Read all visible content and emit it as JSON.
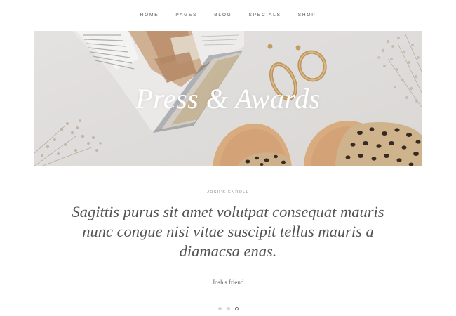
{
  "nav": {
    "items": [
      {
        "label": "HOME",
        "active": false
      },
      {
        "label": "PAGES",
        "active": false
      },
      {
        "label": "BLOG",
        "active": false
      },
      {
        "label": "SPECIALS",
        "active": true
      },
      {
        "label": "SHOP",
        "active": false
      }
    ]
  },
  "hero": {
    "title": "Press & Awards"
  },
  "testimonial": {
    "eyebrow": "JOSH'S ENROLL",
    "quote": "Sagittis purus sit amet volutpat consequat mauris nunc congue nisi vitae suscipit tellus mauris a diamacsa enas.",
    "author": "Josh's friend"
  },
  "slider": {
    "count": 3,
    "active_index": 2
  },
  "colors": {
    "text": "#555555",
    "hero_background": "#eae8e6",
    "dot_inactive": "#d6d6d6"
  }
}
